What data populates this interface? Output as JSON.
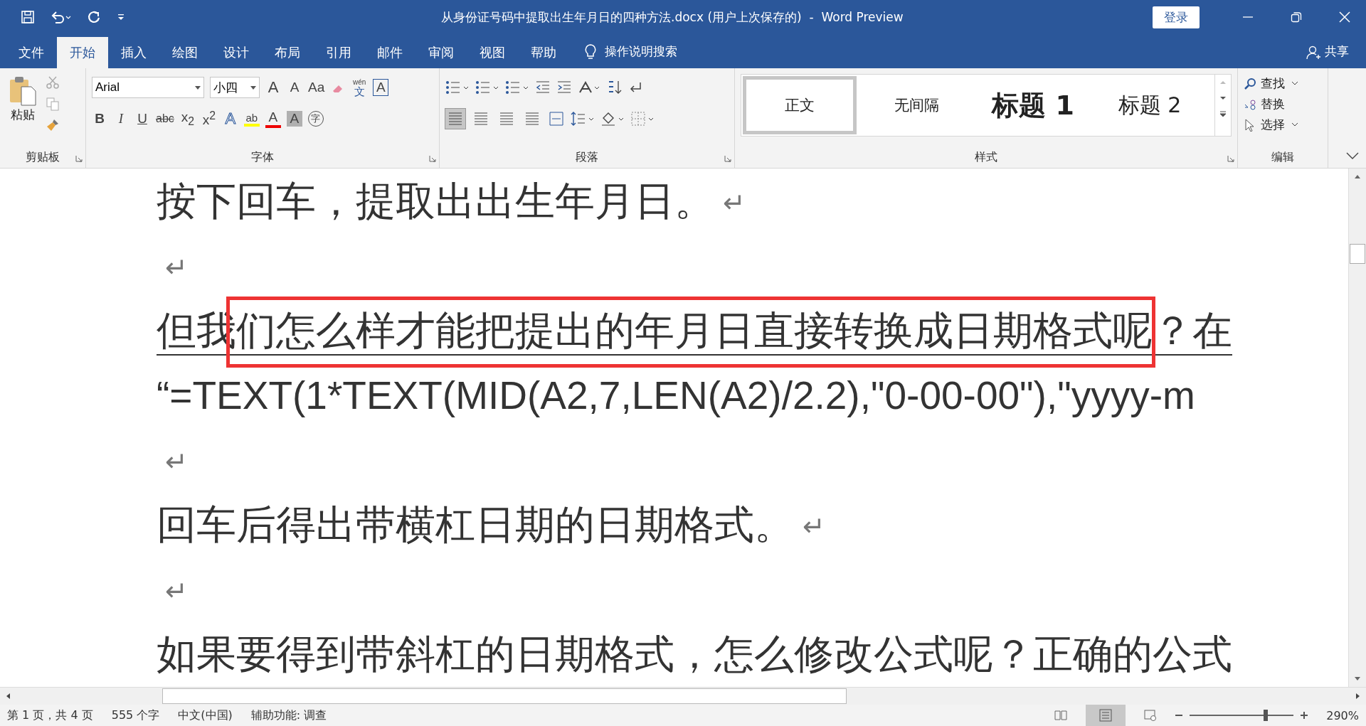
{
  "title_bar": {
    "title": "从身份证号码中提取出生年月日的四种方法.docx (用户上次保存的)  -  Word Preview",
    "sign_in": "登录"
  },
  "menu_tabs": [
    {
      "label": "文件",
      "selected": false
    },
    {
      "label": "开始",
      "selected": true
    },
    {
      "label": "插入",
      "selected": false
    },
    {
      "label": "绘图",
      "selected": false
    },
    {
      "label": "设计",
      "selected": false
    },
    {
      "label": "布局",
      "selected": false
    },
    {
      "label": "引用",
      "selected": false
    },
    {
      "label": "邮件",
      "selected": false
    },
    {
      "label": "审阅",
      "selected": false
    },
    {
      "label": "视图",
      "selected": false
    },
    {
      "label": "帮助",
      "selected": false
    }
  ],
  "tell_me": "操作说明搜索",
  "share": "共享",
  "clipboard": {
    "paste": "粘贴",
    "group": "剪贴板"
  },
  "font": {
    "name": "Arial",
    "size": "小四",
    "group": "字体",
    "grow": "A",
    "shrink": "A",
    "case": "Aa",
    "phonetic_top": "wén",
    "phonetic_bottom": "文",
    "border_char": "A",
    "format_buttons": [
      "B",
      "I",
      "U",
      "abc",
      "x$_{2}$",
      "x$^{2}$"
    ],
    "effects": "A",
    "highlight": "ab",
    "font_color_char": "A",
    "shading": "A",
    "enclose": "字"
  },
  "paragraph": {
    "group": "段落"
  },
  "styles": {
    "group": "样式",
    "items": [
      {
        "label": "正文",
        "kind": "normal",
        "selected": true
      },
      {
        "label": "无间隔",
        "kind": "normal",
        "selected": false
      },
      {
        "label": "标题 1",
        "kind": "heading1",
        "selected": false
      },
      {
        "label": "标题 2",
        "kind": "heading2",
        "selected": false
      }
    ]
  },
  "editing": {
    "group": "编辑",
    "items": [
      "查找",
      "替换",
      "选择"
    ]
  },
  "document": [
    {
      "kind": "text",
      "text": "按下回车，提取出出生年月日。",
      "mark": "↵",
      "underlined": false
    },
    {
      "kind": "blank",
      "mark": "↵"
    },
    {
      "kind": "text",
      "text": "但我们怎么样才能把提出的年月日直接转换成日期格式呢？在",
      "underlined": true
    },
    {
      "kind": "formula",
      "text": "“=TEXT(1*TEXT(MID(A2,7,LEN(A2)/2.2),\"0-00-00\"),\"yyyy-m",
      "underlined": false
    },
    {
      "kind": "blank",
      "mark": "↵"
    },
    {
      "kind": "text",
      "text": "回车后得出带横杠日期的日期格式。",
      "mark": "↵",
      "underlined": false
    },
    {
      "kind": "blank",
      "mark": "↵"
    },
    {
      "kind": "text",
      "text": "如果要得到带斜杠的日期格式，怎么修改公式呢？正确的公式",
      "underlined": false
    }
  ],
  "status_bar": {
    "items": [
      "第 1 页，共 4 页",
      "555 个字",
      "中文(中国)",
      "辅助功能: 调查"
    ],
    "zoom": {
      "level": 0.73,
      "reading": "290%"
    }
  }
}
